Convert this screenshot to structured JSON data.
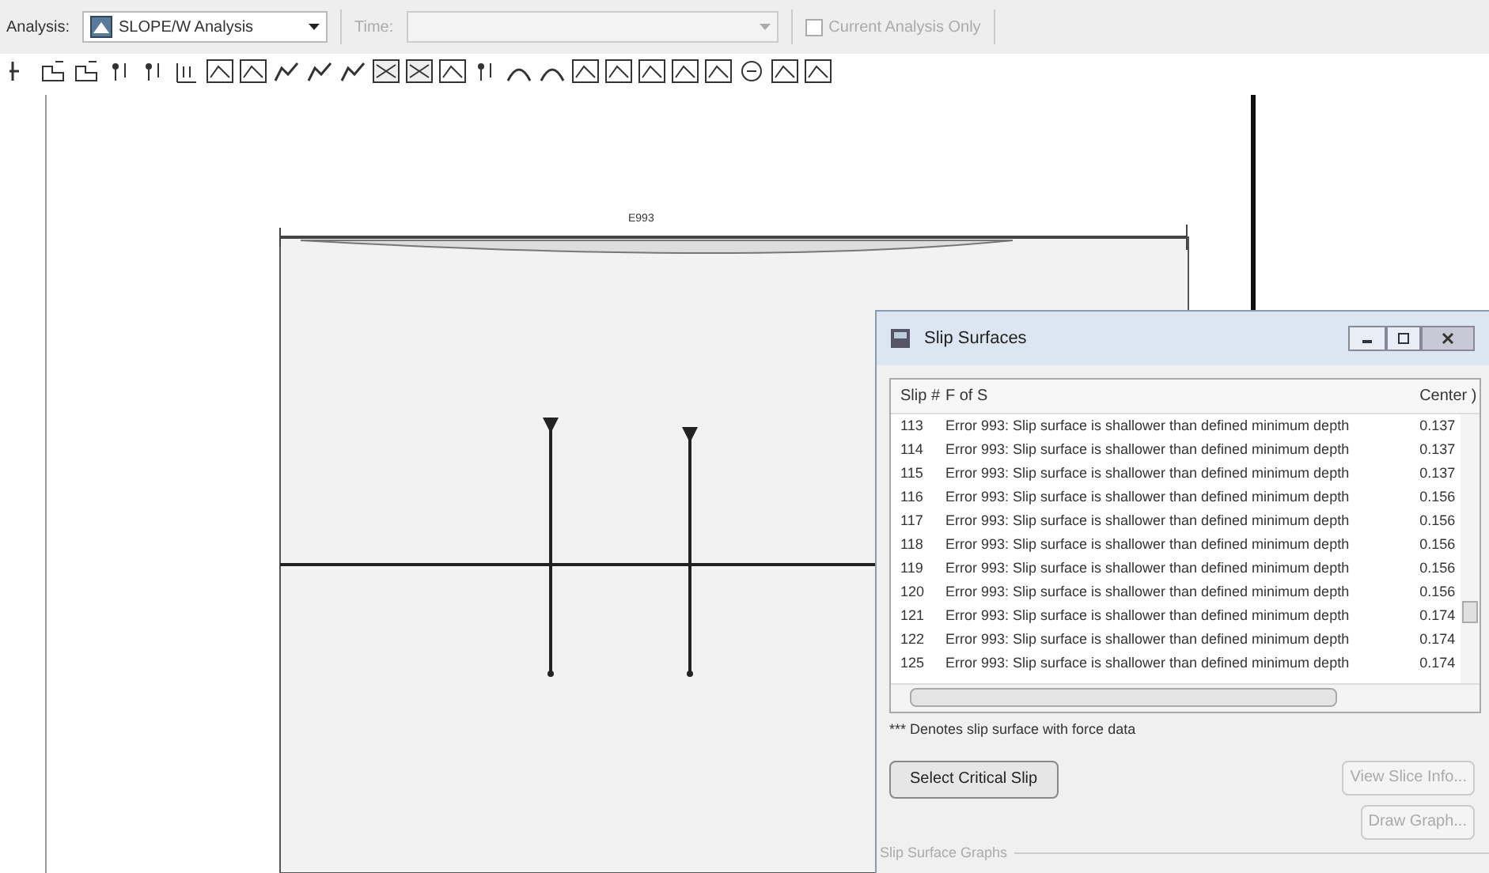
{
  "toolbar": {
    "analysis_label": "Analysis:",
    "analysis_value": "SLOPE/W Analysis",
    "time_label": "Time:",
    "current_analysis_only": {
      "label": "Current Analysis Only",
      "checked": false,
      "disabled": true
    }
  },
  "canvas": {
    "label": "E993"
  },
  "dialog": {
    "title": "Slip Surfaces",
    "columns": [
      "Slip #",
      "F of S",
      "Center )"
    ],
    "rows": [
      {
        "slip": "113",
        "message": "Error 993: Slip surface is shallower than defined minimum depth",
        "center": "0.137"
      },
      {
        "slip": "114",
        "message": "Error 993: Slip surface is shallower than defined minimum depth",
        "center": "0.137"
      },
      {
        "slip": "115",
        "message": "Error 993: Slip surface is shallower than defined minimum depth",
        "center": "0.137"
      },
      {
        "slip": "116",
        "message": "Error 993: Slip surface is shallower than defined minimum depth",
        "center": "0.156"
      },
      {
        "slip": "117",
        "message": "Error 993: Slip surface is shallower than defined minimum depth",
        "center": "0.156"
      },
      {
        "slip": "118",
        "message": "Error 993: Slip surface is shallower than defined minimum depth",
        "center": "0.156"
      },
      {
        "slip": "119",
        "message": "Error 993: Slip surface is shallower than defined minimum depth",
        "center": "0.156"
      },
      {
        "slip": "120",
        "message": "Error 993: Slip surface is shallower than defined minimum depth",
        "center": "0.156"
      },
      {
        "slip": "121",
        "message": "Error 993: Slip surface is shallower than defined minimum depth",
        "center": "0.174"
      },
      {
        "slip": "122",
        "message": "Error 993: Slip surface is shallower than defined minimum depth",
        "center": "0.174"
      },
      {
        "slip": "125",
        "message": "Error 993: Slip surface is shallower than defined minimum depth",
        "center": "0.174"
      }
    ],
    "note": "*** Denotes slip surface with force data",
    "buttons": [
      {
        "label": "Select Critical Slip",
        "disabled": false
      },
      {
        "label": "View Slice Info...",
        "disabled": true
      },
      {
        "label": "Draw Graph...",
        "disabled": true
      }
    ],
    "group_label": "Slip Surface Graphs"
  }
}
